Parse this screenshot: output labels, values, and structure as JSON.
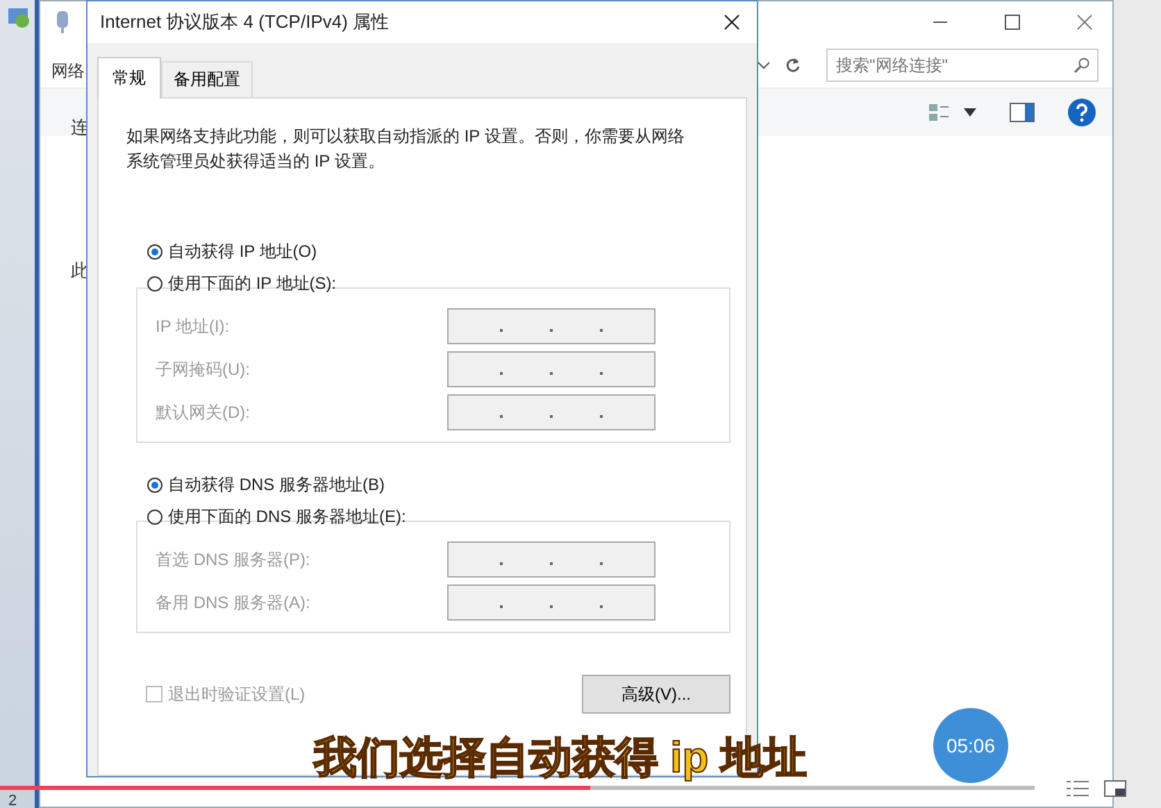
{
  "background_window": {
    "tab_fragment": "网络",
    "label_fragments": [
      "连",
      "此"
    ],
    "search": {
      "placeholder": "搜索\"网络连接\""
    },
    "status_fragment": "2"
  },
  "dialog": {
    "title": "Internet 协议版本 4 (TCP/IPv4) 属性",
    "tabs": [
      {
        "label": "常规",
        "selected": true
      },
      {
        "label": "备用配置",
        "selected": false
      }
    ],
    "description": "如果网络支持此功能，则可以获取自动指派的 IP 设置。否则，你需要从网络系统管理员处获得适当的 IP 设置。",
    "ip_options": [
      {
        "label": "自动获得 IP 地址(O)",
        "selected": true
      },
      {
        "label": "使用下面的 IP 地址(S):",
        "selected": false
      }
    ],
    "ip_fields": [
      {
        "label": "IP 地址(I):",
        "disabled": true
      },
      {
        "label": "子网掩码(U):",
        "disabled": true
      },
      {
        "label": "默认网关(D):",
        "disabled": true
      }
    ],
    "dns_options": [
      {
        "label": "自动获得 DNS 服务器地址(B)",
        "selected": true
      },
      {
        "label": "使用下面的 DNS 服务器地址(E):",
        "selected": false
      }
    ],
    "dns_fields": [
      {
        "label": "首选 DNS 服务器(P):",
        "disabled": true
      },
      {
        "label": "备用 DNS 服务器(A):",
        "disabled": true
      }
    ],
    "validate_on_exit": {
      "label": "退出时验证设置(L)",
      "checked": false,
      "disabled": true
    },
    "advanced_button": "高级(V)..."
  },
  "video_player": {
    "subtitle": "我们选择自动获得 ip 地址",
    "time": "05:06",
    "progress": {
      "level": 0.57
    }
  }
}
